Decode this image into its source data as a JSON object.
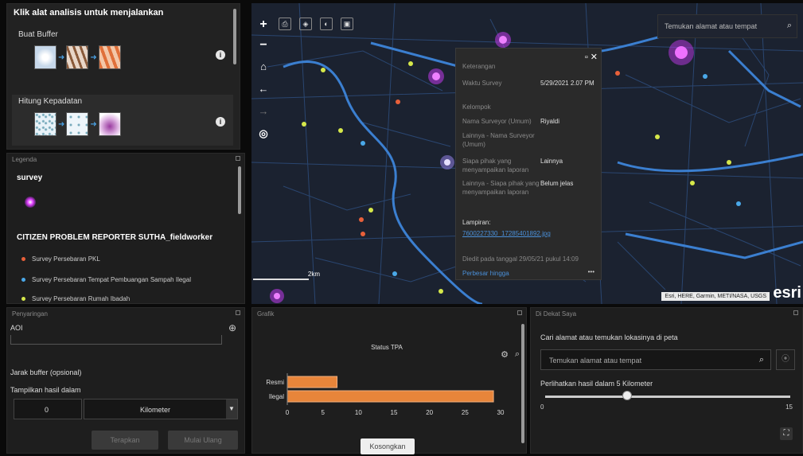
{
  "analysis": {
    "heading": "Klik alat analisis untuk menjalankan",
    "tools": [
      {
        "label": "Buat Buffer"
      },
      {
        "label": "Hitung Kepadatan"
      }
    ]
  },
  "legend": {
    "title": "Legenda",
    "layer1": "survey",
    "layer2": "CITIZEN PROBLEM REPORTER SUTHA_fieldworker",
    "items": [
      {
        "label": "Survey Persebaran PKL",
        "color": "#e8603a"
      },
      {
        "label": "Survey Persebaran Tempat Pembuangan Sampah Ilegal",
        "color": "#4aa8e8"
      },
      {
        "label": "Survey Persebaran Rumah Ibadah",
        "color": "#d6e84a"
      }
    ]
  },
  "map": {
    "search_placeholder": "Temukan alamat atau tempat",
    "zoom_in": "+",
    "zoom_out": "−",
    "attribution": "Esri, HERE, Garmin, METI/NASA, USGS",
    "esri": "esri",
    "scale": "2km"
  },
  "popup": {
    "header": "Keterangan",
    "rows": [
      {
        "k": "Waktu Survey",
        "v": "5/29/2021 2.07 PM"
      },
      {
        "k": "Kelompok",
        "v": ""
      },
      {
        "k": "Nama Surveyor (Umum)",
        "v": "Riyaldi"
      },
      {
        "k": "Lainnya - Nama Surveyor (Umum)",
        "v": ""
      },
      {
        "k": "Siapa pihak yang menyampaikan laporan",
        "v": "Lainnya"
      },
      {
        "k": "Lainnya - Siapa pihak yang menyampaikan laporan",
        "v": "Belum jelas"
      }
    ],
    "attach_label": "Lampiran:",
    "attach_link": "7600227330_17285401892.jpg",
    "edited": "Diedit pada tanggal 29/05/21 pukul 14:09",
    "zoom": "Perbesar hingga"
  },
  "query": {
    "title": "Penyaringan",
    "aoi": "AOI",
    "buffer_label": "Jarak buffer (opsional)",
    "show_label": "Tampilkan hasil dalam",
    "value": "0",
    "unit": "Kilometer",
    "apply": "Terapkan",
    "reset": "Mulai Ulang"
  },
  "chart": {
    "title": "Grafik",
    "clear": "Kosongkan"
  },
  "chart_data": {
    "type": "bar",
    "title": "Status TPA",
    "categories": [
      "Resmi",
      "Ilegal"
    ],
    "values": [
      7,
      29
    ],
    "xlim": [
      0,
      30
    ],
    "ticks": [
      0,
      5,
      10,
      15,
      20,
      25,
      30
    ],
    "color": "#e8853a"
  },
  "nearme": {
    "title": "Di Dekat Saya",
    "prompt": "Cari alamat atau temukan lokasinya di peta",
    "placeholder": "Temukan alamat atau tempat",
    "radius_label": "Perlihatkan hasil dalam 5 Kilometer",
    "min": "0",
    "max": "15",
    "value": 5
  }
}
